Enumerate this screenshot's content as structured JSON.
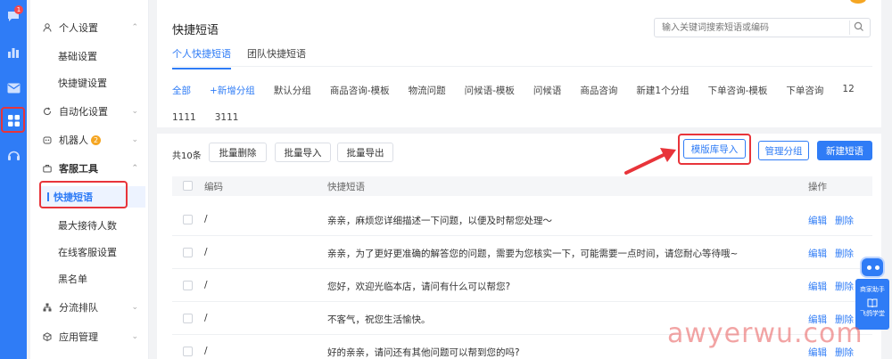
{
  "rail": {
    "badge": "1",
    "icons": [
      "chat-icon",
      "chart-icon",
      "mail-icon",
      "apps-icon",
      "headset-icon"
    ]
  },
  "menu": {
    "personal_settings": "个人设置",
    "basic_settings": "基础设置",
    "shortcut_settings": "快捷键设置",
    "automation_settings": "自动化设置",
    "robot": "机器人",
    "robot_badge": "2",
    "service_tools": "客服工具",
    "quick_phrases": "快捷短语",
    "max_reception": "最大接待人数",
    "online_service_settings": "在线客服设置",
    "blacklist": "黑名单",
    "routing_queue": "分流排队",
    "app_management": "应用管理"
  },
  "page": {
    "title": "快捷短语",
    "search_placeholder": "输入关键词搜索短语或编码",
    "tabs": [
      "个人快捷短语",
      "团队快捷短语"
    ],
    "categories": [
      "全部",
      "+新增分组",
      "默认分组",
      "商品咨询-模板",
      "物流问题",
      "问候语-模板",
      "问候语",
      "商品咨询",
      "新建1个分组",
      "下单咨询-模板",
      "下单咨询",
      "12",
      "1111",
      "3111"
    ]
  },
  "toolbar": {
    "count": "共10条",
    "bulk_delete": "批量删除",
    "bulk_import": "批量导入",
    "bulk_export": "批量导出",
    "template_import": "模版库导入",
    "manage_groups": "管理分组",
    "new_phrase": "新建短语"
  },
  "table": {
    "headers": {
      "code": "编码",
      "phrase": "快捷短语",
      "ops": "操作"
    },
    "edit": "编辑",
    "delete": "删除",
    "rows": [
      {
        "code": "/",
        "text": "亲亲，麻烦您详细描述一下问题，以便及时帮您处理～"
      },
      {
        "code": "/",
        "text": "亲亲，为了更好更准确的解答您的问题，需要为您核实一下，可能需要一点时间，请您耐心等待哦~"
      },
      {
        "code": "/",
        "text": "您好，欢迎光临本店，请问有什么可以帮您?"
      },
      {
        "code": "/",
        "text": "不客气，祝您生活愉快。"
      },
      {
        "code": "/",
        "text": "好的亲亲，请问还有其他问题可以帮到您的吗?"
      }
    ]
  },
  "assistant": {
    "merchant_helper": "商家助手",
    "feige_school": "飞鸽学堂"
  },
  "watermark": "awyerwu.com",
  "colors": {
    "primary": "#2f7cf6",
    "highlight": "#e8343a",
    "badge_red": "#f5474a",
    "badge_orange": "#f5a623"
  }
}
